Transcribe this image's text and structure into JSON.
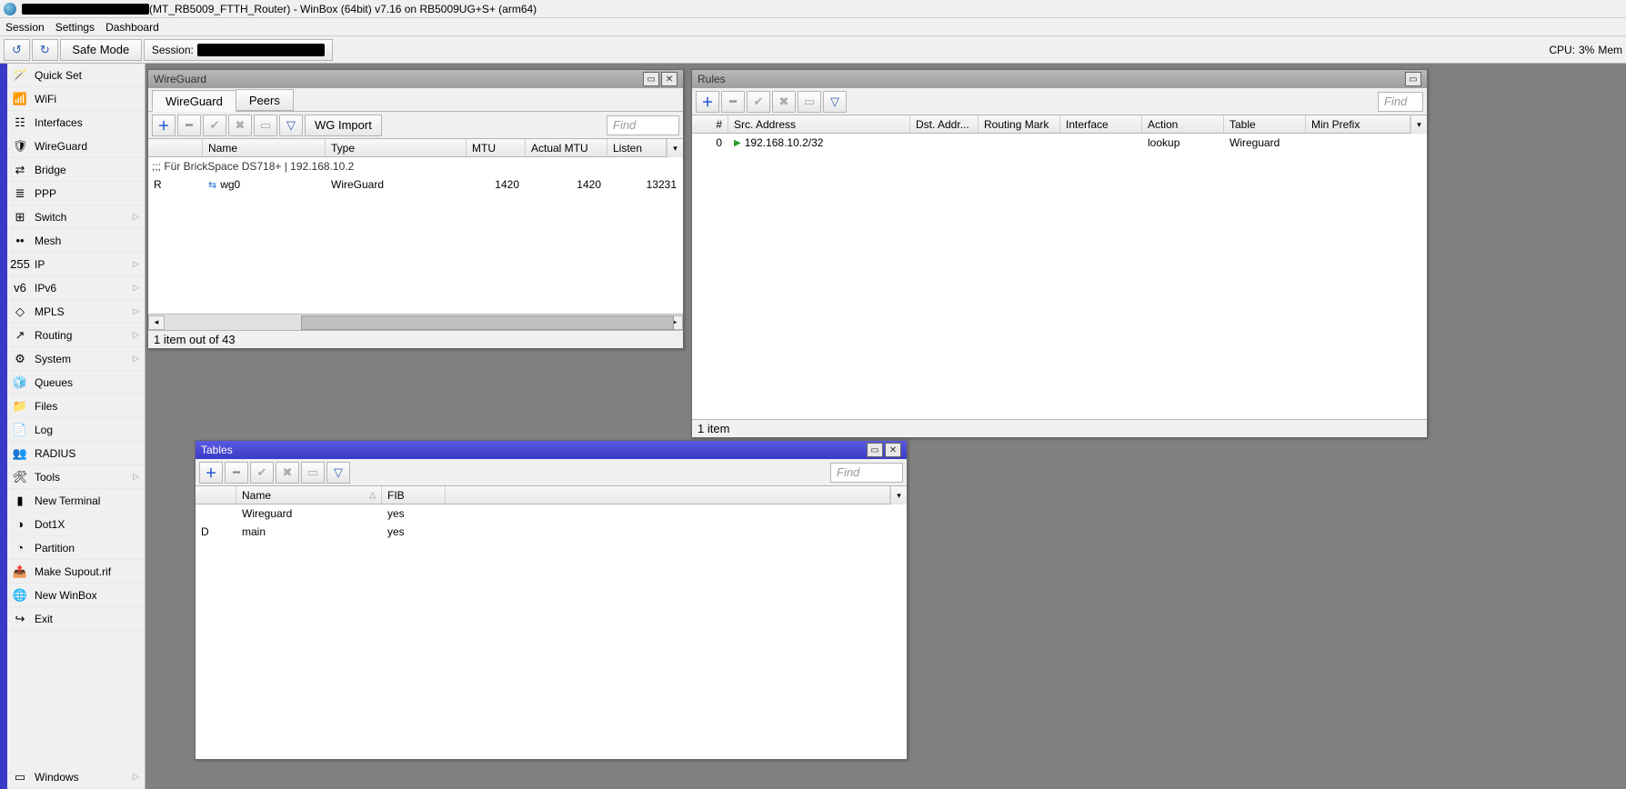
{
  "titlebar": {
    "text": "(MT_RB5009_FTTH_Router) - WinBox (64bit) v7.16 on RB5009UG+S+ (arm64)"
  },
  "menubar": {
    "session": "Session",
    "settings": "Settings",
    "dashboard": "Dashboard"
  },
  "toolbar": {
    "undo": "↺",
    "redo": "↻",
    "safe_mode": "Safe Mode",
    "session_label": "Session:",
    "cpu_label": "CPU:",
    "cpu_value": "3%",
    "mem_label": "Mem"
  },
  "sidebar": {
    "items": [
      {
        "icon": "🪄",
        "label": "Quick Set",
        "expand": false
      },
      {
        "icon": "📶",
        "label": "WiFi",
        "expand": false
      },
      {
        "icon": "☷",
        "label": "Interfaces",
        "expand": false
      },
      {
        "icon": "🛡",
        "label": "WireGuard",
        "expand": false
      },
      {
        "icon": "⇄",
        "label": "Bridge",
        "expand": false
      },
      {
        "icon": "≣",
        "label": "PPP",
        "expand": false
      },
      {
        "icon": "⊞",
        "label": "Switch",
        "expand": true
      },
      {
        "icon": "••",
        "label": "Mesh",
        "expand": false
      },
      {
        "icon": "255",
        "label": "IP",
        "expand": true
      },
      {
        "icon": "v6",
        "label": "IPv6",
        "expand": true
      },
      {
        "icon": "◇",
        "label": "MPLS",
        "expand": true
      },
      {
        "icon": "↗",
        "label": "Routing",
        "expand": true
      },
      {
        "icon": "⚙",
        "label": "System",
        "expand": true
      },
      {
        "icon": "🧊",
        "label": "Queues",
        "expand": false
      },
      {
        "icon": "📁",
        "label": "Files",
        "expand": false
      },
      {
        "icon": "📄",
        "label": "Log",
        "expand": false
      },
      {
        "icon": "👥",
        "label": "RADIUS",
        "expand": false
      },
      {
        "icon": "🛠",
        "label": "Tools",
        "expand": true
      },
      {
        "icon": "▮",
        "label": "New Terminal",
        "expand": false
      },
      {
        "icon": "◑",
        "label": "Dot1X",
        "expand": false
      },
      {
        "icon": "◔",
        "label": "Partition",
        "expand": false
      },
      {
        "icon": "📤",
        "label": "Make Supout.rif",
        "expand": false
      },
      {
        "icon": "🌐",
        "label": "New WinBox",
        "expand": false
      },
      {
        "icon": "↪",
        "label": "Exit",
        "expand": false
      }
    ],
    "windows": {
      "icon": "▭",
      "label": "Windows",
      "expand": true
    }
  },
  "win_wireguard": {
    "title": "WireGuard",
    "tabs": {
      "wireguard": "WireGuard",
      "peers": "Peers"
    },
    "wg_import": "WG Import",
    "find": "Find",
    "cols": {
      "flag": "",
      "name": "Name",
      "type": "Type",
      "mtu": "MTU",
      "actual_mtu": "Actual MTU",
      "listen": "Listen"
    },
    "comment": ";;; Für BrickSpace DS718+ | 192.168.10.2",
    "row": {
      "flag": "R",
      "name": "wg0",
      "type": "WireGuard",
      "mtu": "1420",
      "actual_mtu": "1420",
      "listen": "13231"
    },
    "status": "1 item out of 43"
  },
  "win_rules": {
    "title": "Rules",
    "find": "Find",
    "cols": {
      "num": "#",
      "src": "Src. Address",
      "dst": "Dst. Addr...",
      "mark": "Routing Mark",
      "iface": "Interface",
      "action": "Action",
      "table": "Table",
      "min": "Min Prefix"
    },
    "row": {
      "num": "0",
      "src": "192.168.10.2/32",
      "dst": "",
      "mark": "",
      "iface": "",
      "action": "lookup",
      "table": "Wireguard",
      "min": ""
    },
    "status": "1 item"
  },
  "win_tables": {
    "title": "Tables",
    "find": "Find",
    "cols": {
      "flag": "",
      "name": "Name",
      "fib": "FIB"
    },
    "rows": [
      {
        "flag": "",
        "name": "Wireguard",
        "fib": "yes"
      },
      {
        "flag": "D",
        "name": "main",
        "fib": "yes"
      }
    ]
  }
}
